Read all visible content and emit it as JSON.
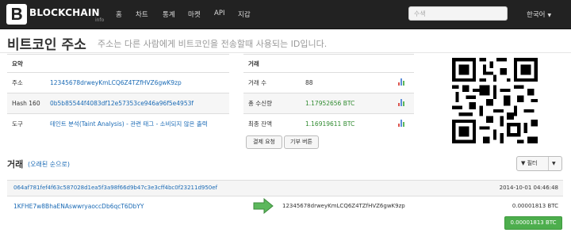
{
  "nav": {
    "brand": "BLOCKCHAIN",
    "brand_sub": "info",
    "items": [
      "홈",
      "차트",
      "통계",
      "마켓",
      "API",
      "지갑"
    ],
    "search_placeholder": "수색",
    "language": "한국어"
  },
  "page": {
    "title": "비트코인 주소",
    "subtitle": "주소는 다른 사람에게 비트코인을 전송할때 사용되는 ID입니다."
  },
  "summary": {
    "header": "요약",
    "rows": [
      {
        "label": "주소",
        "value": "12345678drweyKmLCQ6Z4TZfHVZ6gwK9zp"
      },
      {
        "label": "Hash 160",
        "value": "0b5b85544f4083df12e57353ce946a96f5e4953f"
      },
      {
        "label": "도구",
        "value": "테인트 분석(Taint Analysis) - 관련 태그 - 소비되지 않은 출력"
      }
    ]
  },
  "transactions_box": {
    "header": "거래",
    "rows": [
      {
        "label": "거래 수",
        "value": "88"
      },
      {
        "label": "총 수신량",
        "value": "1.17952656 BTC"
      },
      {
        "label": "최종 잔액",
        "value": "1.16919611 BTC"
      }
    ],
    "buttons": [
      "결제 요청",
      "기부 버튼"
    ]
  },
  "tx_section": {
    "title": "거래",
    "subtitle": "(오래된 순으로)",
    "filter_label": "필터"
  },
  "transaction": {
    "hash": "064af781fef4f63c587028d1ea5f3a98f66d9b47c3e3cff4bc0f23211d950ef",
    "time": "2014-10-01 04:46:48",
    "from": "1KFHE7w8BhaENAswwryaoccDb6qcT6DbYY",
    "to": "12345678drweyKmLCQ6Z4TZfHVZ6gwK9zp",
    "amount": "0.00001813 BTC",
    "total": "0.00001813 BTC"
  },
  "colors": {
    "navbar": "#222222",
    "link": "#1a6ab5",
    "green": "#2f8a2f",
    "total_button": "#4dae4d"
  }
}
